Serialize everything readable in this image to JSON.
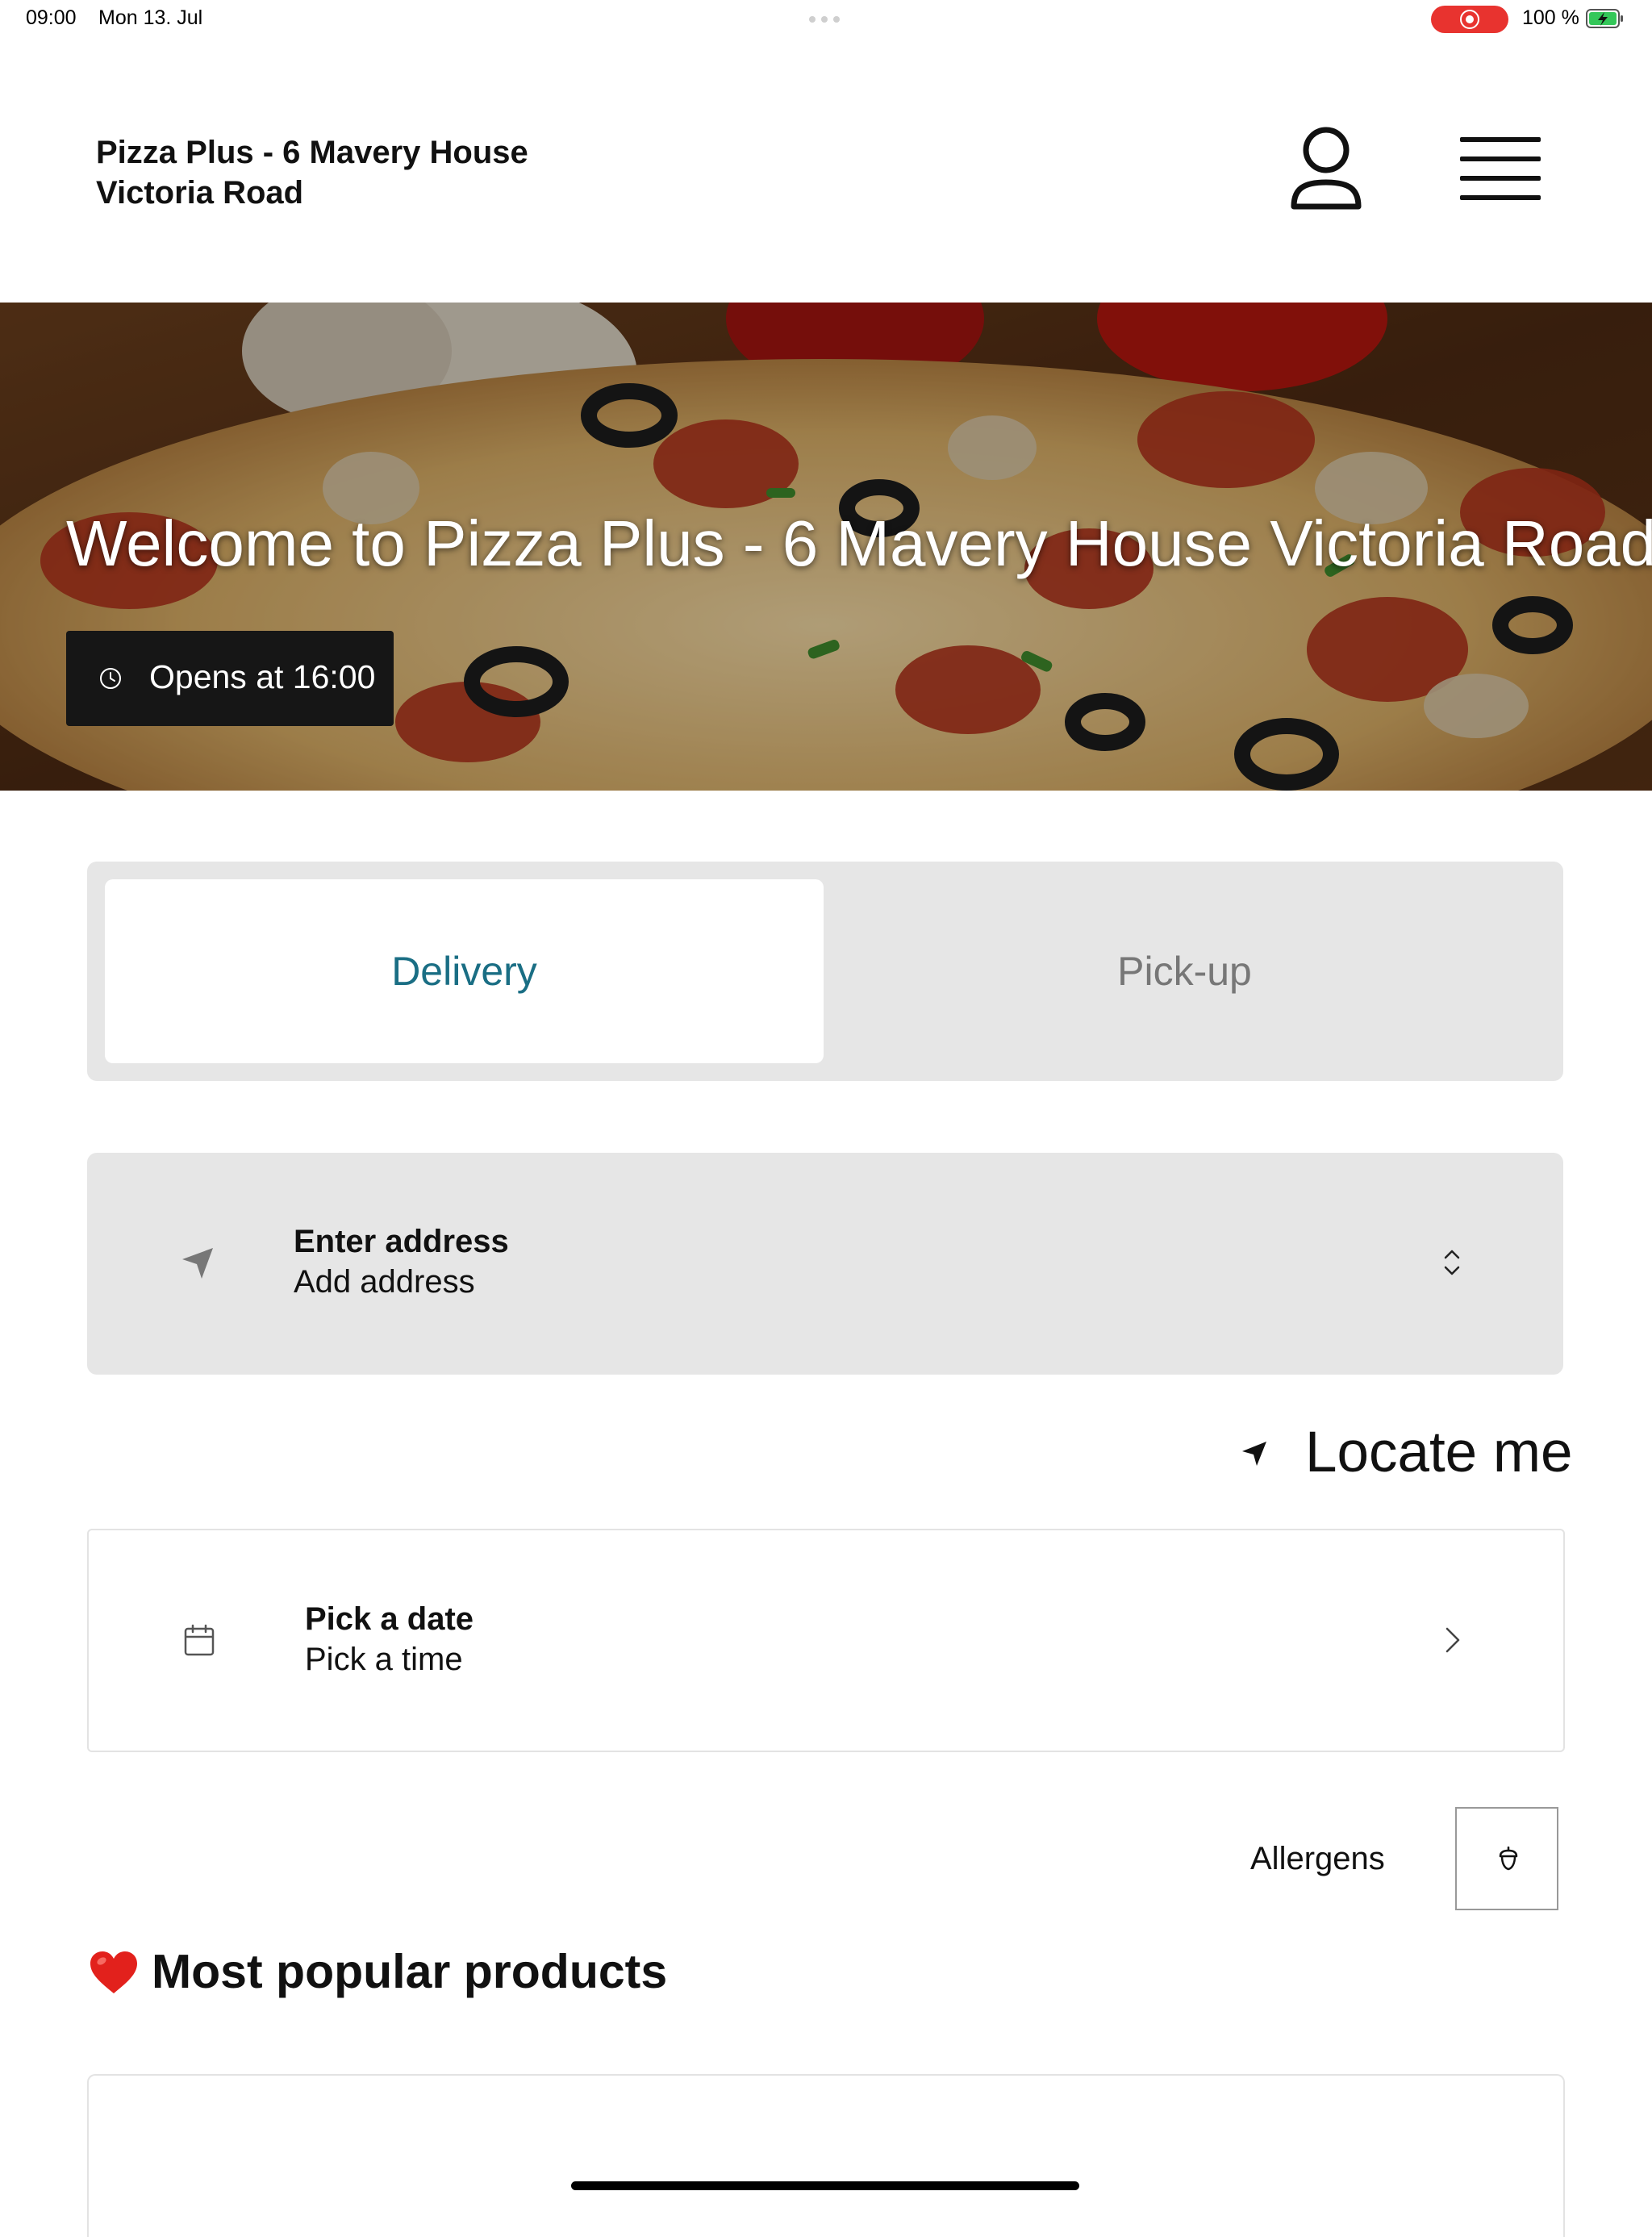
{
  "status_bar": {
    "time": "09:00",
    "date": "Mon 13. Jul",
    "battery_percent": "100 %",
    "battery_level": 1.0
  },
  "header": {
    "store_name": "Pizza Plus - 6 Mavery House Victoria Road",
    "account_icon": "user-icon",
    "menu_icon": "hamburger-menu-icon"
  },
  "hero": {
    "welcome_title": "Welcome to Pizza Plus - 6 Mavery House Victoria Road",
    "opening_status": "Opens at 16:00",
    "opening_icon": "clock-icon"
  },
  "order_type": {
    "tabs": [
      {
        "label": "Delivery",
        "selected": true
      },
      {
        "label": "Pick-up",
        "selected": false
      }
    ],
    "selected_color": "#1a6e84"
  },
  "address": {
    "title": "Enter address",
    "subtitle": "Add address",
    "icon": "navigation-arrow-icon"
  },
  "locate": {
    "label": "Locate me",
    "icon": "location-arrow-icon"
  },
  "schedule": {
    "title": "Pick a date",
    "subtitle": "Pick a time",
    "icon": "calendar-icon"
  },
  "allergens": {
    "label": "Allergens",
    "icon": "acorn-icon"
  },
  "popular": {
    "emoji": "❤️",
    "title": "Most popular products"
  }
}
